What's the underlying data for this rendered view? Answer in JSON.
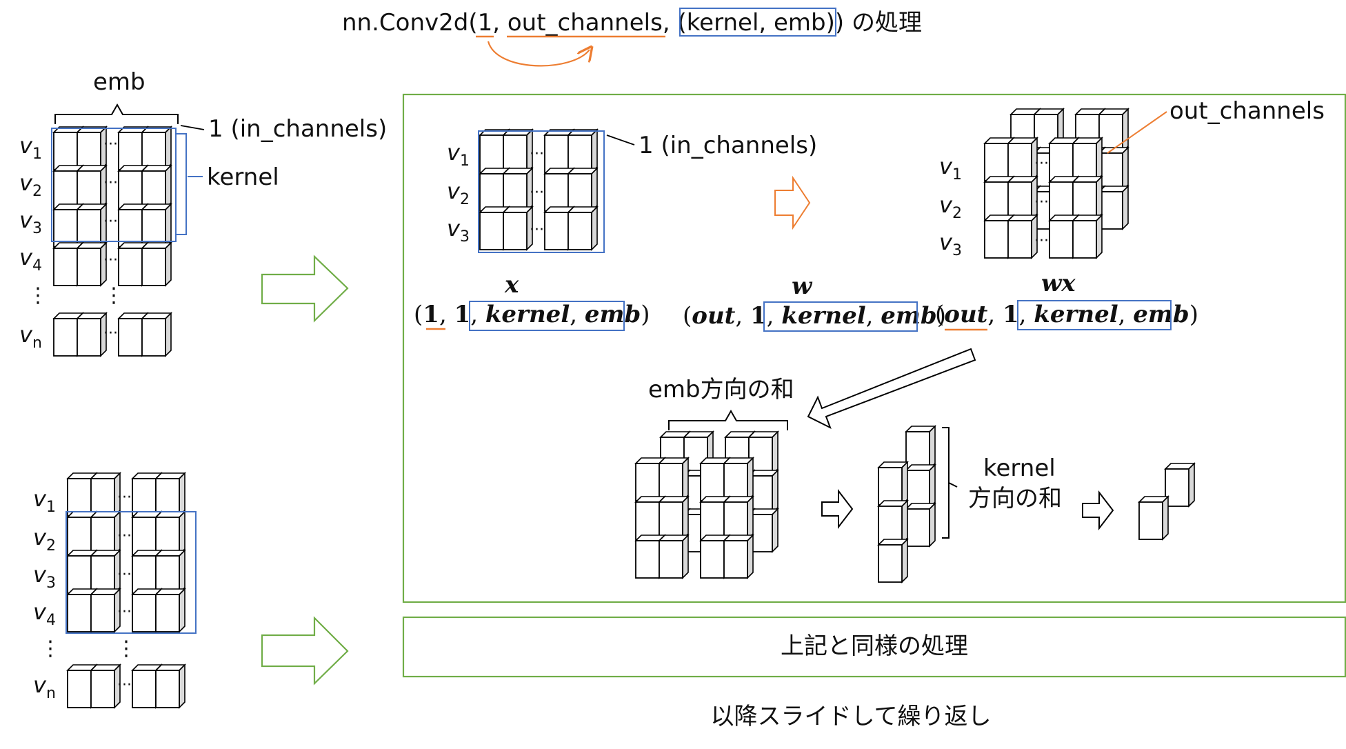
{
  "title": {
    "prefix": "nn.Conv2d(",
    "arg1": "1",
    "sep1": ", ",
    "arg2": "out_channels",
    "sep2": ", ",
    "arg3": "(kernel, emb)",
    "suffix": ") の処理"
  },
  "left_top": {
    "emb_label": "emb",
    "in_channels_label": "1 (in_channels)",
    "kernel_label": "kernel",
    "rows": [
      "v1",
      "v2",
      "v3",
      "v4",
      "vn"
    ]
  },
  "left_bottom": {
    "rows": [
      "v1",
      "v2",
      "v3",
      "v4",
      "vn"
    ]
  },
  "process_box": {
    "in_channels_label": "1 (in_channels)",
    "out_channels_label": "out_channels",
    "x_rows": [
      "v1",
      "v2",
      "v3"
    ],
    "wx_rows": [
      "v1",
      "v2",
      "v3"
    ],
    "x_name": "x",
    "w_name": "w",
    "wx_name": "wx",
    "x_shape": {
      "open": "(",
      "a": "1",
      "b": "1",
      "c": "kernel",
      "d": "emb",
      "close": ")"
    },
    "w_shape": {
      "open": "(",
      "a": "out",
      "b": "1",
      "c": "kernel",
      "d": "emb",
      "close": ")"
    },
    "wx_shape": {
      "open": "(",
      "a": "out",
      "b": "1",
      "c": "kernel",
      "d": "emb",
      "close": ")"
    },
    "emb_sum_label": "emb方向の和",
    "kernel_sum_label_1": "kernel",
    "kernel_sum_label_2": "方向の和"
  },
  "same_process_box": {
    "label": "上記と同様の処理"
  },
  "footer": "以降スライドして繰り返し",
  "colors": {
    "frame_green": "#70ad47",
    "blue": "#4472c4",
    "orange": "#ed7d31",
    "cube_side": "#d9d9d9",
    "black": "#000000"
  }
}
